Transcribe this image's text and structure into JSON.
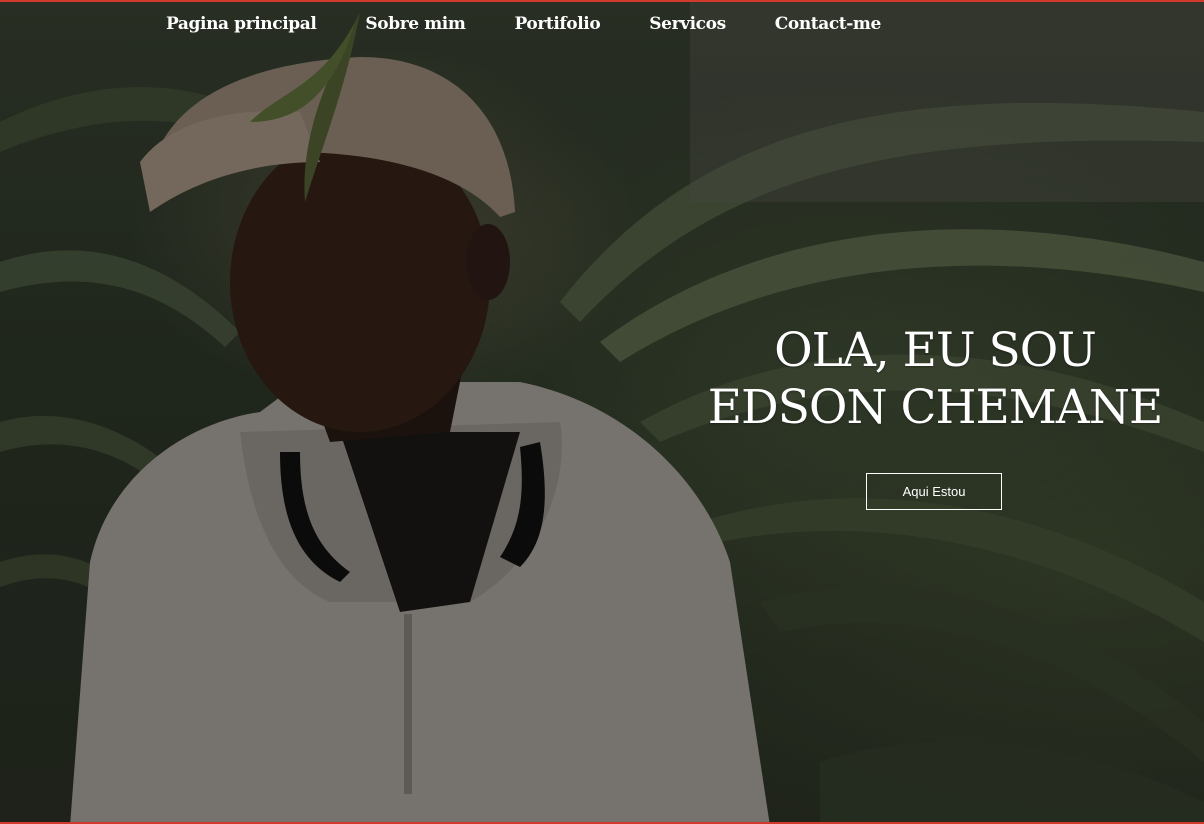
{
  "nav": {
    "items": [
      {
        "label": "Pagina principal"
      },
      {
        "label": "Sobre mim"
      },
      {
        "label": "Portifolio"
      },
      {
        "label": "Servicos"
      },
      {
        "label": "Contact-me"
      }
    ]
  },
  "hero": {
    "headline_line1": "OLA, EU SOU",
    "headline_line2": "EDSON CHEMANE",
    "cta_label": "Aqui Estou"
  },
  "colors": {
    "accent_border": "#d23a2e",
    "text": "#ffffff"
  }
}
